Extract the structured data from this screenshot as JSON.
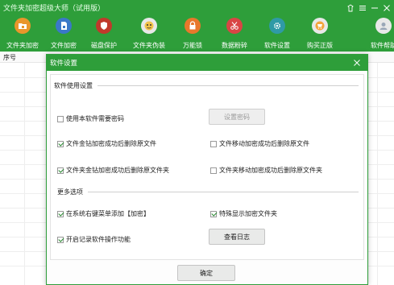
{
  "app": {
    "title": "文件夹加密超级大师（试用版）"
  },
  "toolbar": {
    "items": [
      {
        "label": "文件夹加密",
        "icon": "folder-lock-icon",
        "color": "#e9962b"
      },
      {
        "label": "文件加密",
        "icon": "file-lock-icon",
        "color": "#3a78c8"
      },
      {
        "label": "磁盘保护",
        "icon": "shield-icon",
        "color": "#c0392b"
      },
      {
        "label": "文件夹伪装",
        "icon": "disguise-icon",
        "color": "#e8e8e8"
      },
      {
        "label": "万能锁",
        "icon": "padlock-icon",
        "color": "#e8782b"
      },
      {
        "label": "数据粉碎",
        "icon": "shredder-icon",
        "color": "#d94545"
      },
      {
        "label": "软件设置",
        "icon": "gear-icon",
        "color": "#2f9aa6"
      },
      {
        "label": "购买正版",
        "icon": "cart-icon",
        "color": "#e8e8e8"
      },
      {
        "label": "软件帮助",
        "icon": "user-help-icon",
        "color": "#e8e8e8"
      }
    ]
  },
  "table": {
    "col_seq": "序号"
  },
  "dialog": {
    "title": "软件设置",
    "section1_title": "软件使用设置",
    "use_password_label": "使用本软件需要密码",
    "set_password_button": "设置密码",
    "options": [
      {
        "label": "文件金钻加密成功后删除原文件",
        "checked": true
      },
      {
        "label": "文件移动加密成功后删除原文件",
        "checked": false
      },
      {
        "label": "文件夹金钻加密成功后删除原文件夹",
        "checked": true
      },
      {
        "label": "文件夹移动加密成功后删除原文件夹",
        "checked": false
      }
    ],
    "section2_title": "更多选项",
    "context_menu_label": "在系统右键菜单添加【加密】",
    "special_display_label": "特殊显示加密文件夹",
    "log_label": "开启记录软件操作功能",
    "view_log_button": "查看日志",
    "ok_button": "确定"
  }
}
